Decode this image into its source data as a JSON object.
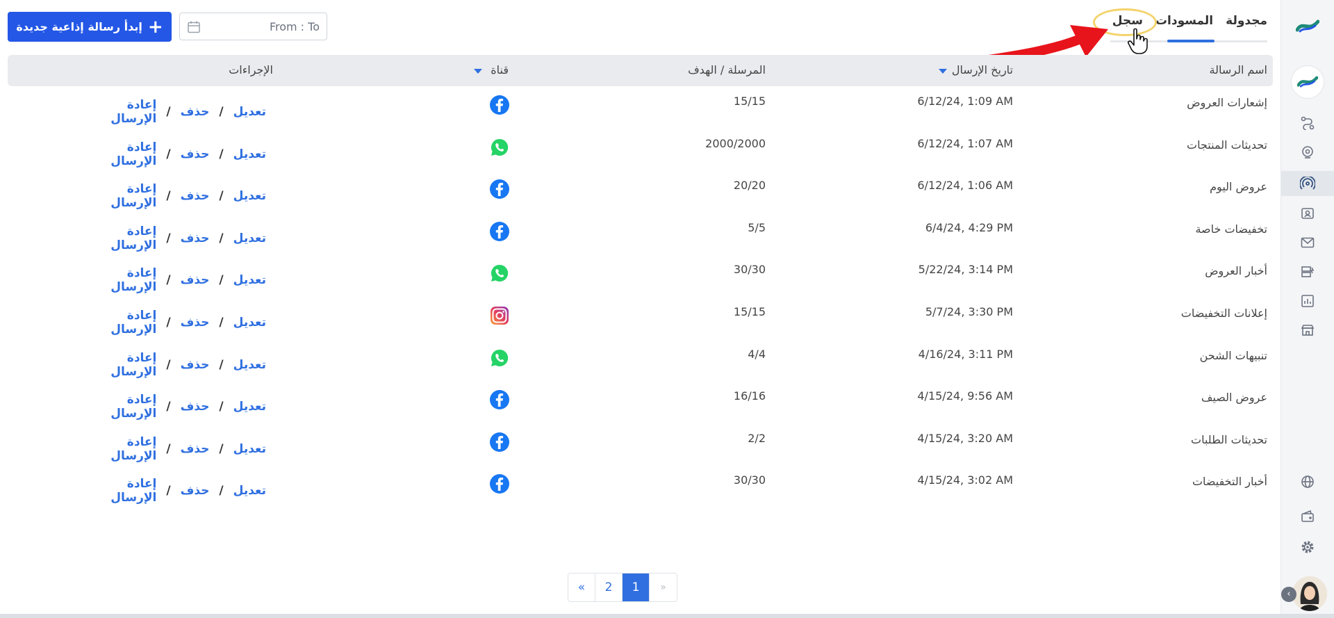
{
  "tabs": [
    {
      "label": "مجدولة"
    },
    {
      "label": "المسودات"
    },
    {
      "label": "سجل"
    }
  ],
  "toolbar": {
    "new_broadcast_label": "إبدأ رسالة إذاعية جديدة",
    "date_range_placeholder": "From : To"
  },
  "table": {
    "headers": {
      "name": "اسم الرسالة",
      "date": "تاريخ الإرسال",
      "sent_target": "المرسلة / الهدف",
      "channel": "قناة",
      "actions": "الإجراءات"
    },
    "action_labels": {
      "edit": "تعديل",
      "delete": "حذف",
      "resend": "إعادة الإرسال",
      "separator": "/"
    },
    "rows": [
      {
        "name": "إشعارات العروض",
        "date": "6/12/24, 1:09 AM",
        "count": "15/15",
        "channel": "facebook"
      },
      {
        "name": "تحديثات المنتجات",
        "date": "6/12/24, 1:07 AM",
        "count": "2000/2000",
        "channel": "whatsapp"
      },
      {
        "name": "عروض اليوم",
        "date": "6/12/24, 1:06 AM",
        "count": "20/20",
        "channel": "facebook"
      },
      {
        "name": "تخفيضات خاصة",
        "date": "6/4/24, 4:29 PM",
        "count": "5/5",
        "channel": "facebook"
      },
      {
        "name": "أخبار العروض",
        "date": "5/22/24, 3:14 PM",
        "count": "30/30",
        "channel": "whatsapp"
      },
      {
        "name": "إعلانات التخفيضات",
        "date": "5/7/24, 3:30 PM",
        "count": "15/15",
        "channel": "instagram"
      },
      {
        "name": "تنبيهات الشحن",
        "date": "4/16/24, 3:11 PM",
        "count": "4/4",
        "channel": "whatsapp"
      },
      {
        "name": "عروض الصيف",
        "date": "4/15/24, 9:56 AM",
        "count": "16/16",
        "channel": "facebook"
      },
      {
        "name": "تحديثات الطلبات",
        "date": "4/15/24, 3:20 AM",
        "count": "2/2",
        "channel": "facebook"
      },
      {
        "name": "أخبار التخفيضات",
        "date": "4/15/24, 3:02 AM",
        "count": "30/30",
        "channel": "facebook"
      }
    ]
  },
  "pagination": {
    "first": "«",
    "pages": [
      "2",
      "1"
    ],
    "current": "1",
    "prev": "»"
  },
  "colors": {
    "primary": "#2457e6",
    "link": "#2f6fe0",
    "facebook": "#1877f2",
    "whatsapp": "#25d366",
    "annotation_arrow": "#e8141b"
  },
  "sidebar_icons": [
    "logo-icon",
    "workspace-icon",
    "flow-icon",
    "bot-icon",
    "broadcast-icon",
    "contacts-icon",
    "mail-icon",
    "templates-icon",
    "reports-icon",
    "store-icon",
    "globe-icon",
    "wallet-icon",
    "gear-icon"
  ]
}
